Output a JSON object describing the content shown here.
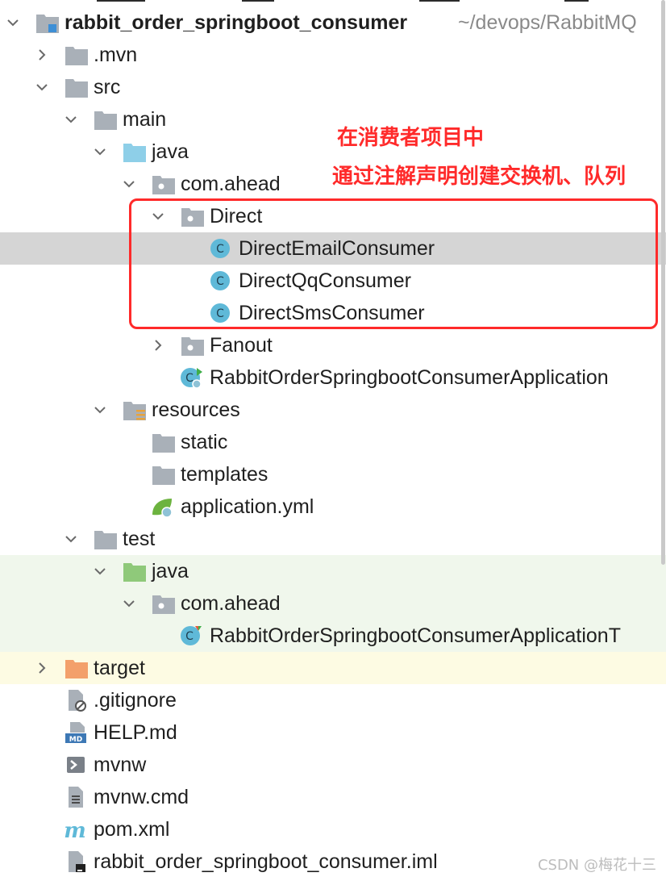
{
  "tree": {
    "root": {
      "name": "rabbit_order_springboot_consumer",
      "path_hint": "~/devops/RabbitMQ"
    },
    "nodes": [
      {
        "label": ".mvn"
      },
      {
        "label": "src"
      },
      {
        "label": "main"
      },
      {
        "label": "java"
      },
      {
        "label": "com.ahead"
      },
      {
        "label": "Direct"
      },
      {
        "label": "DirectEmailConsumer"
      },
      {
        "label": "DirectQqConsumer"
      },
      {
        "label": "DirectSmsConsumer"
      },
      {
        "label": "Fanout"
      },
      {
        "label": "RabbitOrderSpringbootConsumerApplication"
      },
      {
        "label": "resources"
      },
      {
        "label": "static"
      },
      {
        "label": "templates"
      },
      {
        "label": "application.yml"
      },
      {
        "label": "test"
      },
      {
        "label": "java"
      },
      {
        "label": "com.ahead"
      },
      {
        "label": "RabbitOrderSpringbootConsumerApplicationT"
      },
      {
        "label": "target"
      },
      {
        "label": ".gitignore"
      },
      {
        "label": "HELP.md"
      },
      {
        "label": "mvnw"
      },
      {
        "label": "mvnw.cmd"
      },
      {
        "label": "pom.xml"
      },
      {
        "label": "rabbit_order_springboot_consumer.iml"
      }
    ]
  },
  "annotation": {
    "line1": "在消费者项目中",
    "line2": "通过注解声明创建交换机、队列",
    "color": "#ff2a2a"
  },
  "watermark": "CSDN @梅花十三",
  "colors": {
    "selected_row": "#d5d5d5",
    "test_row": "#f0f7ec",
    "excluded_row": "#fdfbe3",
    "folder": "#a9b0b8",
    "source_folder": "#8ecfe8",
    "test_folder": "#8fc97a",
    "excluded_folder": "#f3a06b",
    "class_icon": "#5fb9d8"
  }
}
